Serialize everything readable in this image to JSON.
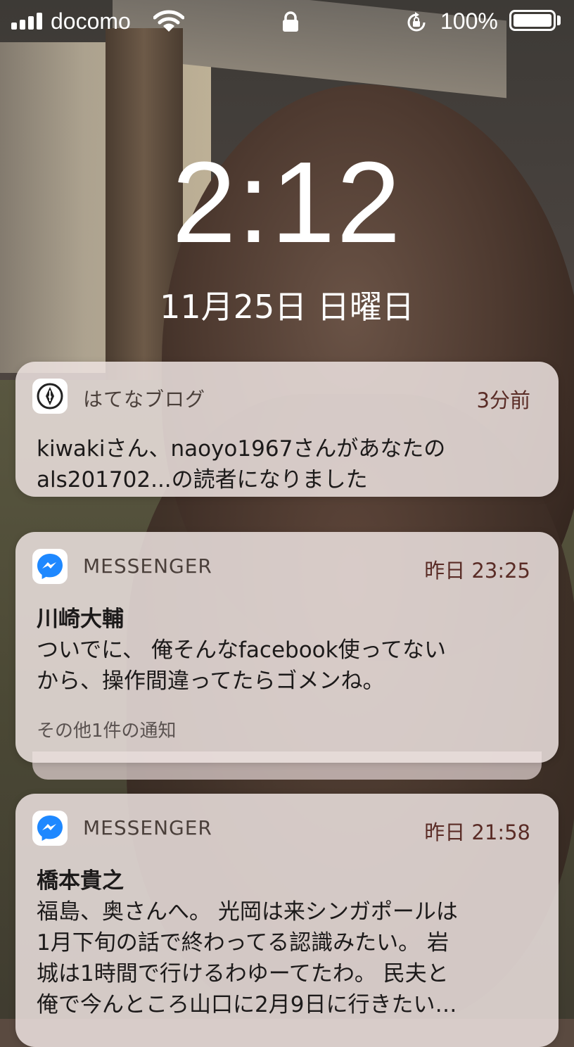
{
  "status_bar": {
    "carrier": "docomo",
    "battery_percent": "100%",
    "icons": [
      "signal-icon",
      "wifi-icon",
      "lock-icon",
      "rotation-lock-icon",
      "battery-icon"
    ]
  },
  "lock_screen": {
    "time": "2:12",
    "date": "11月25日 日曜日"
  },
  "notifications": [
    {
      "app": "はてなブログ",
      "time": "3分前",
      "icon": "hatena-blog-icon",
      "title": "",
      "lines": [
        "kiwakiさん、naoyo1967さんがあなたの",
        "als201702...の読者になりました"
      ]
    },
    {
      "app": "MESSENGER",
      "time": "昨日 23:25",
      "icon": "messenger-icon",
      "title": "川崎大輔",
      "lines": [
        "ついでに、 俺そんなfacebook使ってない",
        "から、操作間違ってたらゴメンね。"
      ],
      "more": "その他1件の通知"
    },
    {
      "app": "MESSENGER",
      "time": "昨日 21:58",
      "icon": "messenger-icon",
      "title": "橋本貴之",
      "lines": [
        "福島、奥さんへ。 光岡は来シンガポールは",
        "1月下旬の話で終わってる認識みたい。 岩",
        "城は1時間で行けるわゆーてたわ。 民夫と",
        "俺で今んところ山口に2月9日に行きたい…"
      ]
    }
  ],
  "colors": {
    "card_bg": "#ece2e0",
    "time_text": "#5a2c26",
    "messenger_blue": "#1e88ff"
  }
}
